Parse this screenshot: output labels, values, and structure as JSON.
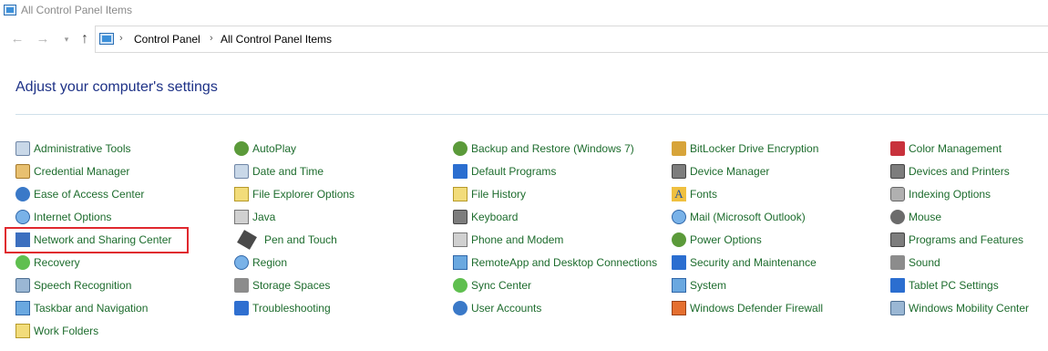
{
  "window": {
    "title": "All Control Panel Items"
  },
  "nav": {
    "back_icon": "back-arrow-icon",
    "forward_icon": "forward-arrow-icon",
    "recent_icon": "chevron-down-icon",
    "up_icon": "up-arrow-icon"
  },
  "address": {
    "crumbs": [
      "Control Panel",
      "All Control Panel Items"
    ]
  },
  "main": {
    "heading": "Adjust your computer's settings"
  },
  "columns": [
    {
      "items": [
        {
          "label": "Administrative Tools",
          "icon": "administrative-tools-icon"
        },
        {
          "label": "Credential Manager",
          "icon": "credential-manager-icon"
        },
        {
          "label": "Ease of Access Center",
          "icon": "ease-of-access-icon"
        },
        {
          "label": "Internet Options",
          "icon": "internet-options-icon"
        },
        {
          "label": "Network and Sharing Center",
          "icon": "network-icon"
        },
        {
          "label": "Recovery",
          "icon": "recovery-icon"
        },
        {
          "label": "Speech Recognition",
          "icon": "microphone-icon"
        },
        {
          "label": "Taskbar and Navigation",
          "icon": "taskbar-icon"
        },
        {
          "label": "Work Folders",
          "icon": "folder-icon"
        }
      ]
    },
    {
      "items": [
        {
          "label": "AutoPlay",
          "icon": "autoplay-icon"
        },
        {
          "label": "Date and Time",
          "icon": "clock-icon"
        },
        {
          "label": "File Explorer Options",
          "icon": "folder-options-icon"
        },
        {
          "label": "Java",
          "icon": "java-icon"
        },
        {
          "label": "Pen and Touch",
          "icon": "pen-icon"
        },
        {
          "label": "Region",
          "icon": "globe-icon"
        },
        {
          "label": "Storage Spaces",
          "icon": "storage-icon"
        },
        {
          "label": "Troubleshooting",
          "icon": "troubleshooting-icon"
        }
      ]
    },
    {
      "items": [
        {
          "label": "Backup and Restore (Windows 7)",
          "icon": "backup-icon"
        },
        {
          "label": "Default Programs",
          "icon": "default-programs-icon"
        },
        {
          "label": "File History",
          "icon": "file-history-icon"
        },
        {
          "label": "Keyboard",
          "icon": "keyboard-icon"
        },
        {
          "label": "Phone and Modem",
          "icon": "phone-icon"
        },
        {
          "label": "RemoteApp and Desktop Connections",
          "icon": "remote-desktop-icon"
        },
        {
          "label": "Sync Center",
          "icon": "sync-icon"
        },
        {
          "label": "User Accounts",
          "icon": "users-icon"
        }
      ]
    },
    {
      "items": [
        {
          "label": "BitLocker Drive Encryption",
          "icon": "bitlocker-icon"
        },
        {
          "label": "Device Manager",
          "icon": "device-manager-icon"
        },
        {
          "label": "Fonts",
          "icon": "fonts-icon"
        },
        {
          "label": "Mail (Microsoft Outlook)",
          "icon": "mail-icon"
        },
        {
          "label": "Power Options",
          "icon": "power-icon"
        },
        {
          "label": "Security and Maintenance",
          "icon": "flag-icon"
        },
        {
          "label": "System",
          "icon": "system-icon"
        },
        {
          "label": "Windows Defender Firewall",
          "icon": "firewall-icon"
        }
      ]
    },
    {
      "items": [
        {
          "label": "Color Management",
          "icon": "color-management-icon"
        },
        {
          "label": "Devices and Printers",
          "icon": "printer-icon"
        },
        {
          "label": "Indexing Options",
          "icon": "indexing-icon"
        },
        {
          "label": "Mouse",
          "icon": "mouse-icon"
        },
        {
          "label": "Programs and Features",
          "icon": "programs-icon"
        },
        {
          "label": "Sound",
          "icon": "speaker-icon"
        },
        {
          "label": "Tablet PC Settings",
          "icon": "tablet-icon"
        },
        {
          "label": "Windows Mobility Center",
          "icon": "mobility-icon"
        }
      ]
    }
  ],
  "highlight": {
    "target": "Network and Sharing Center",
    "color": "#e0282e"
  },
  "colors": {
    "link": "#1d6c2d",
    "heading": "#1e3287"
  }
}
